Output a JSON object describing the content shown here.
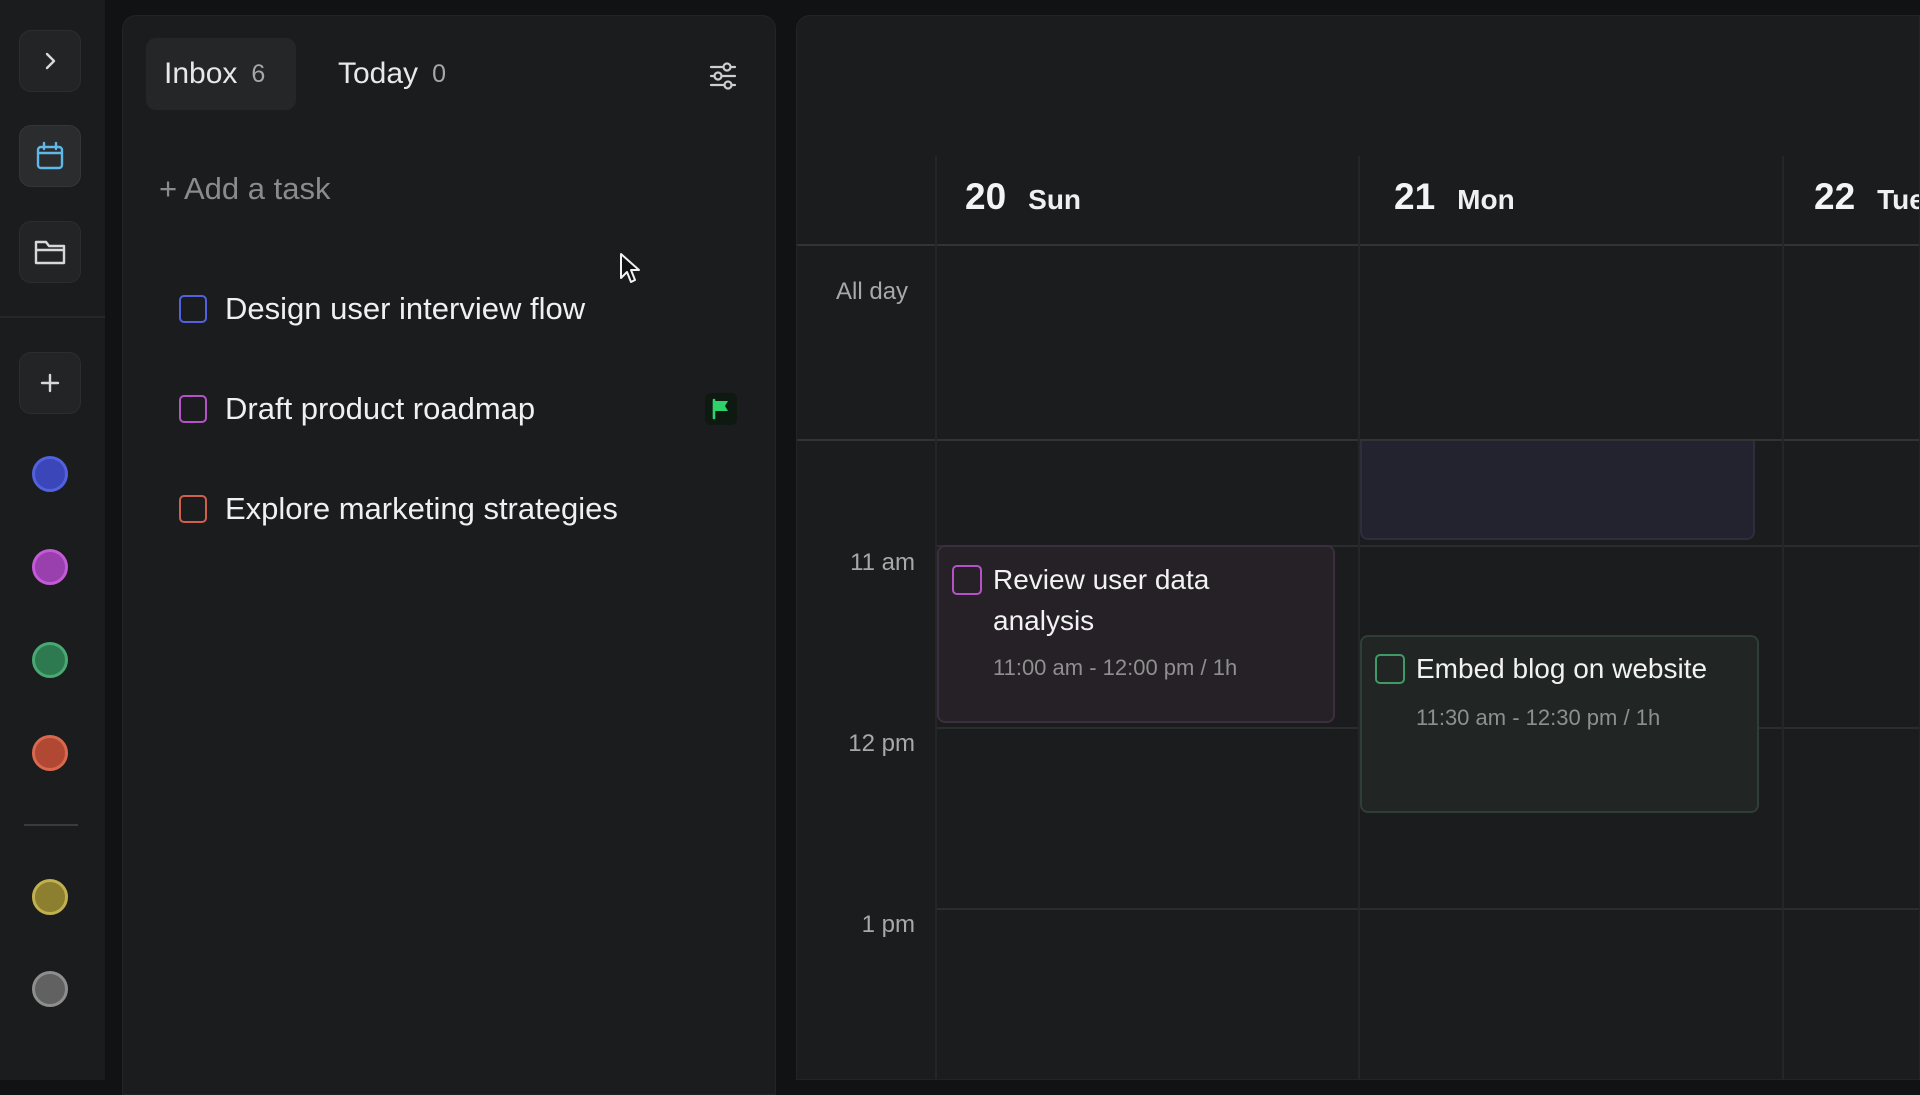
{
  "sidebar": {
    "icons": [
      "chevron-right-icon",
      "calendar-icon",
      "folder-icon",
      "plus-icon"
    ],
    "colors": {
      "blue": "#5161e0",
      "purple": "#b652c8",
      "green": "#3f9a68",
      "red": "#d0604c",
      "yellow": "#b3a44a",
      "gray": "#8a8a8a"
    }
  },
  "tasks_panel": {
    "tabs": [
      {
        "label": "Inbox",
        "count": "6"
      },
      {
        "label": "Today",
        "count": "0"
      }
    ],
    "add_task_label": "+ Add a task",
    "items": [
      {
        "label": "Design user interview flow",
        "color": "#5161e0"
      },
      {
        "label": "Draft product roadmap",
        "color": "#b652c8",
        "flag_color": "#2fd26a"
      },
      {
        "label": "Explore marketing strategies",
        "color": "#d0604c"
      }
    ]
  },
  "calendar": {
    "days": [
      {
        "num": "20",
        "name": "Sun"
      },
      {
        "num": "21",
        "name": "Mon"
      },
      {
        "num": "22",
        "name": "Tue"
      }
    ],
    "all_day_label": "All day",
    "time_labels": [
      "11 am",
      "12 pm",
      "1 pm"
    ],
    "events": [
      {
        "title_line1": "Review user data",
        "title_line2": "analysis",
        "time": "11:00 am - 12:00 pm / 1h",
        "color": "#b652c8"
      },
      {
        "title_line1": "Embed blog on website",
        "time": "11:30 am - 12:30 pm / 1h",
        "color": "#3f9a68"
      }
    ]
  }
}
